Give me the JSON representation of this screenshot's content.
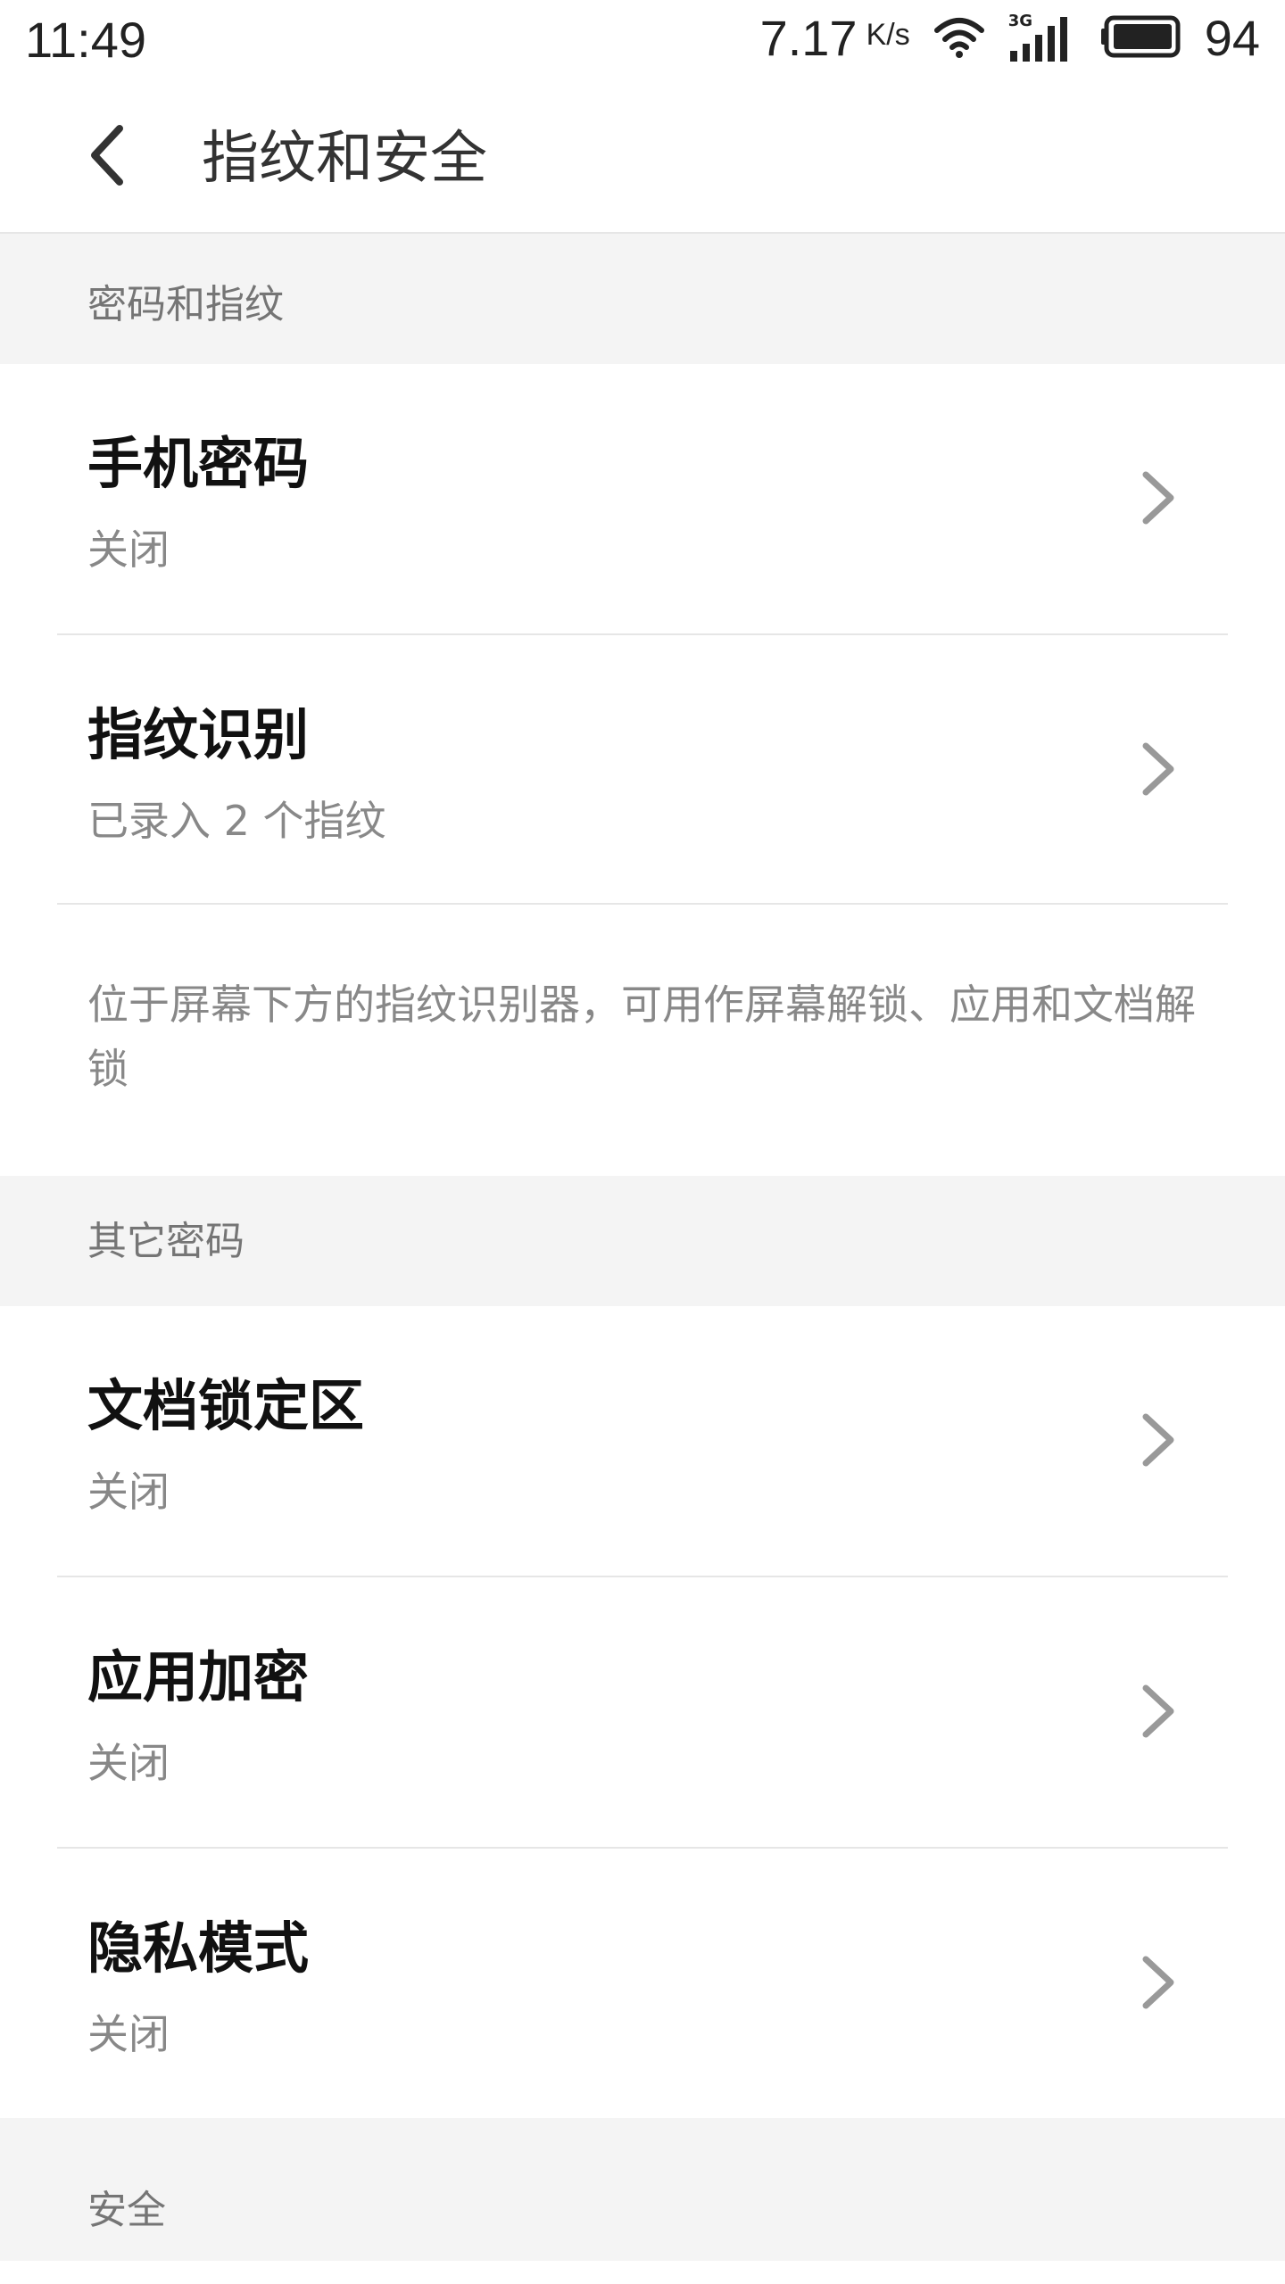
{
  "status_bar": {
    "time": "11:49",
    "net_speed": "7.17",
    "net_speed_unit": "K/s",
    "network_type": "3G",
    "battery_level": "94"
  },
  "app_bar": {
    "title": "指纹和安全"
  },
  "sections": [
    {
      "header": "密码和指纹",
      "items": [
        {
          "title": "手机密码",
          "subtitle": "关闭"
        },
        {
          "title": "指纹识别",
          "subtitle": "已录入 2 个指纹"
        }
      ],
      "description": "位于屏幕下方的指纹识别器，可用作屏幕解锁、应用和文档解锁"
    },
    {
      "header": "其它密码",
      "items": [
        {
          "title": "文档锁定区",
          "subtitle": "关闭"
        },
        {
          "title": "应用加密",
          "subtitle": "关闭"
        },
        {
          "title": "隐私模式",
          "subtitle": "关闭"
        }
      ]
    },
    {
      "header": "安全"
    }
  ],
  "icons": {
    "back": "chevron-left-icon",
    "item_arrow": "chevron-right-icon",
    "wifi": "wifi-icon",
    "signal": "cell-signal-icon",
    "battery": "battery-icon"
  },
  "colors": {
    "section_bg": "#f4f4f4",
    "divider": "#e6e6e6",
    "primary_text": "#111111",
    "secondary_text": "#888888"
  }
}
